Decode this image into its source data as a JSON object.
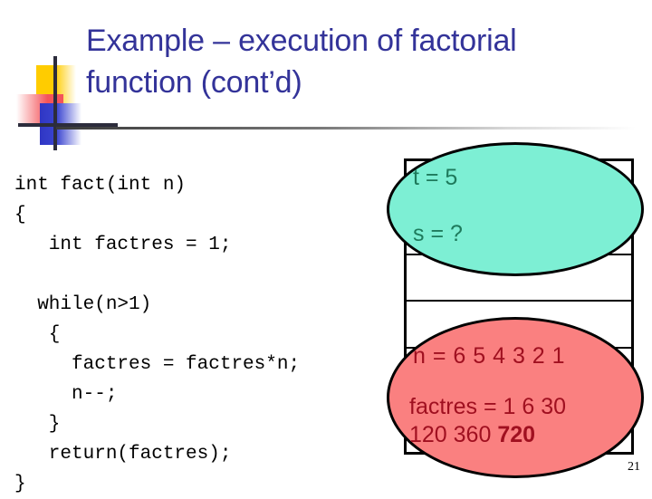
{
  "slide": {
    "title": "Example – execution of factorial\nfunction (cont’d)",
    "number": "21",
    "title_color": "#333399"
  },
  "code": {
    "text": "int fact(int n)\n{\n   int factres = 1;\n\n  while(n>1)\n   {\n     factres = factres*n;\n     n--;\n   }\n   return(factres);\n}"
  },
  "trace": {
    "teal_color": "#7DEFD4",
    "teal_text_color": "#1E7A5C",
    "red_color": "#FA8080",
    "red_text_color": "#A01020",
    "rows": {
      "t": "t = 5",
      "s": "s = ?",
      "n": "n = 6  5  4  3  2  1",
      "factres_line1": "factres = 1   6   30",
      "factres_line2_a": "120   360   ",
      "factres_line2_b": "720"
    }
  }
}
